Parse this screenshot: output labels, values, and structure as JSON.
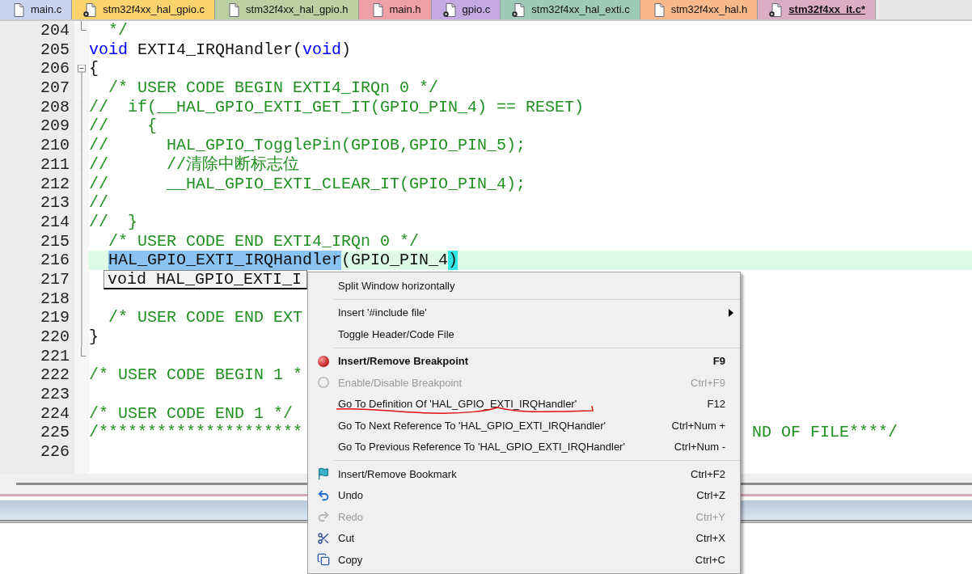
{
  "tabs": [
    {
      "label": "main.c",
      "color": "#c8d4f0",
      "badge": false,
      "selected": false
    },
    {
      "label": "stm32f4xx_hal_gpio.c",
      "color": "#fbd36d",
      "badge": true,
      "selected": false
    },
    {
      "label": "stm32f4xx_hal_gpio.h",
      "color": "#bccfa2",
      "badge": false,
      "selected": false
    },
    {
      "label": "main.h",
      "color": "#ef9fa6",
      "badge": false,
      "selected": false
    },
    {
      "label": "gpio.c",
      "color": "#c4a9e2",
      "badge": true,
      "selected": false
    },
    {
      "label": "stm32f4xx_hal_exti.c",
      "color": "#9fcab8",
      "badge": true,
      "selected": false
    },
    {
      "label": "stm32f4xx_hal.h",
      "color": "#f7b88a",
      "badge": false,
      "selected": false
    },
    {
      "label": "stm32f4xx_it.c*",
      "color": "#dbaec4",
      "badge": true,
      "selected": true
    }
  ],
  "editor": {
    "lines": [
      {
        "number": "204",
        "fold_box": false,
        "fold_end": true,
        "in_block": false,
        "current": false,
        "tokens": [
          {
            "kind": "comment",
            "text": "  */"
          }
        ]
      },
      {
        "number": "205",
        "fold_box": false,
        "fold_end": false,
        "in_block": false,
        "current": false,
        "tokens": [
          {
            "kind": "keyword",
            "text": "void"
          },
          {
            "kind": "plain",
            "text": " EXTI4_IRQHandler("
          },
          {
            "kind": "keyword",
            "text": "void"
          },
          {
            "kind": "plain",
            "text": ")"
          }
        ]
      },
      {
        "number": "206",
        "fold_box": true,
        "fold_end": false,
        "in_block": false,
        "current": false,
        "tokens": [
          {
            "kind": "plain",
            "text": "{"
          }
        ]
      },
      {
        "number": "207",
        "fold_box": false,
        "fold_end": false,
        "in_block": true,
        "current": false,
        "tokens": [
          {
            "kind": "comment",
            "text": "  /* USER CODE BEGIN EXTI4_IRQn 0 */"
          }
        ]
      },
      {
        "number": "208",
        "fold_box": false,
        "fold_end": false,
        "in_block": true,
        "current": false,
        "tokens": [
          {
            "kind": "comment",
            "text": "//  if(__HAL_GPIO_EXTI_GET_IT(GPIO_PIN_4) == RESET)"
          }
        ]
      },
      {
        "number": "209",
        "fold_box": false,
        "fold_end": false,
        "in_block": true,
        "current": false,
        "tokens": [
          {
            "kind": "comment",
            "text": "//    {"
          }
        ]
      },
      {
        "number": "210",
        "fold_box": false,
        "fold_end": false,
        "in_block": true,
        "current": false,
        "tokens": [
          {
            "kind": "comment",
            "text": "//      HAL_GPIO_TogglePin(GPIOB,GPIO_PIN_5);"
          }
        ]
      },
      {
        "number": "211",
        "fold_box": false,
        "fold_end": false,
        "in_block": true,
        "current": false,
        "tokens": [
          {
            "kind": "comment",
            "text": "//      //清除中断标志位"
          }
        ]
      },
      {
        "number": "212",
        "fold_box": false,
        "fold_end": false,
        "in_block": true,
        "current": false,
        "tokens": [
          {
            "kind": "comment",
            "text": "//      __HAL_GPIO_EXTI_CLEAR_IT(GPIO_PIN_4);"
          }
        ]
      },
      {
        "number": "213",
        "fold_box": false,
        "fold_end": false,
        "in_block": true,
        "current": false,
        "tokens": [
          {
            "kind": "comment",
            "text": "//"
          }
        ]
      },
      {
        "number": "214",
        "fold_box": false,
        "fold_end": false,
        "in_block": true,
        "current": false,
        "tokens": [
          {
            "kind": "comment",
            "text": "//  }"
          }
        ]
      },
      {
        "number": "215",
        "fold_box": false,
        "fold_end": false,
        "in_block": true,
        "current": false,
        "tokens": [
          {
            "kind": "comment",
            "text": "  /* USER CODE END EXTI4_IRQn 0 */"
          }
        ]
      },
      {
        "number": "216",
        "fold_box": false,
        "fold_end": false,
        "in_block": true,
        "current": true,
        "tokens": [
          {
            "kind": "selected",
            "text": "HAL_GPIO_EXTI_IRQHandler"
          },
          {
            "kind": "plain",
            "text": "(GPIO_PIN_4"
          },
          {
            "kind": "match",
            "text": ")"
          }
        ]
      },
      {
        "number": "217",
        "fold_box": false,
        "fold_end": false,
        "in_block": true,
        "current": false,
        "tokens": [
          {
            "kind": "tooltip",
            "text": "void HAL_GPIO_EXTI_I"
          }
        ]
      },
      {
        "number": "218",
        "fold_box": false,
        "fold_end": false,
        "in_block": true,
        "current": false
      },
      {
        "number": "219",
        "fold_box": false,
        "fold_end": false,
        "in_block": true,
        "current": false,
        "tokens": [
          {
            "kind": "comment",
            "text": "  /* USER CODE END EXT"
          }
        ]
      },
      {
        "number": "220",
        "fold_box": false,
        "fold_end": false,
        "in_block": true,
        "current": false,
        "tokens": [
          {
            "kind": "plain",
            "text": "}"
          }
        ]
      },
      {
        "number": "221",
        "fold_box": false,
        "fold_end": true,
        "in_block": false,
        "current": false
      },
      {
        "number": "222",
        "fold_box": false,
        "fold_end": false,
        "in_block": false,
        "current": false,
        "tokens": [
          {
            "kind": "comment",
            "text": "/* USER CODE BEGIN 1 *"
          }
        ]
      },
      {
        "number": "223",
        "fold_box": false,
        "fold_end": false,
        "in_block": false,
        "current": false
      },
      {
        "number": "224",
        "fold_box": false,
        "fold_end": false,
        "in_block": false,
        "current": false,
        "tokens": [
          {
            "kind": "comment",
            "text": "/* USER CODE END 1 */"
          }
        ]
      },
      {
        "number": "225",
        "fold_box": false,
        "fold_end": false,
        "in_block": false,
        "current": false,
        "tokens": [
          {
            "kind": "comment",
            "text": "/*********************"
          }
        ],
        "tail": "ND OF FILE****/"
      },
      {
        "number": "226",
        "fold_box": false,
        "fold_end": false,
        "in_block": false,
        "current": false
      }
    ]
  },
  "context_menu": {
    "items": [
      {
        "kind": "plain",
        "label": "Split Window horizontally",
        "default": false,
        "disabled": false
      },
      {
        "kind": "separator"
      },
      {
        "kind": "plain",
        "label": "Insert '#include file'",
        "default": false,
        "disabled": false,
        "submenu": true
      },
      {
        "kind": "plain",
        "label": "Toggle Header/Code File",
        "default": false,
        "disabled": false
      },
      {
        "kind": "separator"
      },
      {
        "kind": "breakpoint",
        "label": "Insert/Remove Breakpoint",
        "shortcut": "F9",
        "default": true,
        "disabled": false
      },
      {
        "kind": "toggle",
        "label": "Enable/Disable Breakpoint",
        "shortcut": "Ctrl+F9",
        "default": false,
        "disabled": true
      },
      {
        "kind": "plain",
        "label": "Go To Definition Of 'HAL_GPIO_EXTI_IRQHandler'",
        "shortcut": "F12",
        "default": false,
        "disabled": false,
        "annotated": true
      },
      {
        "kind": "plain",
        "label": "Go To Next Reference To 'HAL_GPIO_EXTI_IRQHandler'",
        "shortcut": "Ctrl+Num +",
        "default": false,
        "disabled": false
      },
      {
        "kind": "plain",
        "label": "Go To Previous Reference To 'HAL_GPIO_EXTI_IRQHandler'",
        "shortcut": "Ctrl+Num -",
        "default": false,
        "disabled": false
      },
      {
        "kind": "separator"
      },
      {
        "kind": "bookmark",
        "label": "Insert/Remove Bookmark",
        "shortcut": "Ctrl+F2",
        "default": false,
        "disabled": false
      },
      {
        "kind": "undo",
        "label": "Undo",
        "shortcut": "Ctrl+Z",
        "default": false,
        "disabled": false
      },
      {
        "kind": "redo",
        "label": "Redo",
        "shortcut": "Ctrl+Y",
        "default": false,
        "disabled": true
      },
      {
        "kind": "cut",
        "label": "Cut",
        "shortcut": "Ctrl+X",
        "default": false,
        "disabled": false
      },
      {
        "kind": "copy",
        "label": "Copy",
        "shortcut": "Ctrl+C",
        "default": false,
        "disabled": false
      }
    ]
  }
}
